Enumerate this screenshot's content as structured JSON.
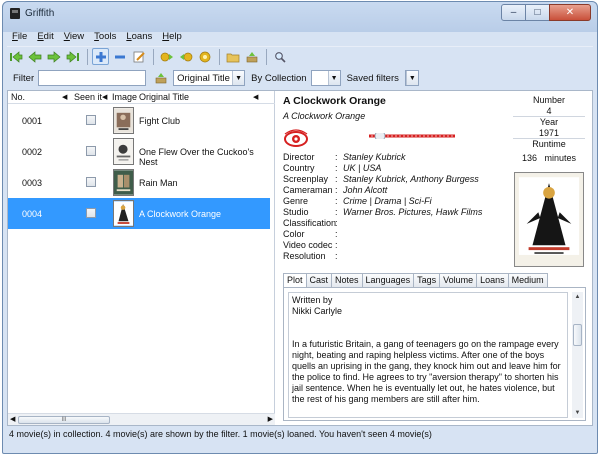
{
  "window": {
    "title": "Griffith",
    "icon": "griffith-app-icon"
  },
  "window_buttons": {
    "minimize": "–",
    "maximize": "□",
    "close": "✕"
  },
  "menu": [
    {
      "label": "File",
      "mnemonic": "F",
      "rest": "ile"
    },
    {
      "label": "Edit",
      "mnemonic": "E",
      "rest": "dit"
    },
    {
      "label": "View",
      "mnemonic": "V",
      "rest": "iew"
    },
    {
      "label": "Tools",
      "mnemonic": "T",
      "rest": "ools"
    },
    {
      "label": "Loans",
      "mnemonic": "L",
      "rest": "oans"
    },
    {
      "label": "Help",
      "mnemonic": "H",
      "rest": "elp"
    }
  ],
  "toolbar": {
    "icons": [
      "first-icon",
      "previous-icon",
      "next-icon",
      "last-icon",
      "add-icon",
      "delete-icon",
      "edit-icon",
      "loan-icon",
      "return-icon",
      "email-icon",
      "open-folder-icon",
      "export-icon",
      "search-icon"
    ]
  },
  "filter": {
    "label": "Filter",
    "value": "",
    "field_select": "Original Title",
    "collection_button": "By Collection",
    "collection_select": "",
    "saved_filters_label": "Saved filters",
    "saved_filters_select": ""
  },
  "list": {
    "columns": {
      "no": "No.",
      "seen": "Seen it",
      "image": "Image",
      "original_title": "Original Title"
    },
    "rows": [
      {
        "no": "0001",
        "seen": false,
        "title": "Fight Club",
        "selected": false
      },
      {
        "no": "0002",
        "seen": false,
        "title": "One Flew Over the Cuckoo's Nest",
        "selected": false
      },
      {
        "no": "0003",
        "seen": false,
        "title": "Rain Man",
        "selected": false
      },
      {
        "no": "0004",
        "seen": false,
        "title": "A Clockwork Orange",
        "selected": true
      }
    ],
    "scroll_grip": "III"
  },
  "detail": {
    "title": "A Clockwork Orange",
    "original_title": "A Clockwork Orange",
    "rating": 0.1,
    "fields": [
      {
        "key": "Director",
        "value": "Stanley Kubrick"
      },
      {
        "key": "Country",
        "value": "UK | USA"
      },
      {
        "key": "Screenplay",
        "value": "Stanley Kubrick, Anthony Burgess"
      },
      {
        "key": "Cameraman",
        "value": "John Alcott"
      },
      {
        "key": "Genre",
        "value": "Crime | Drama | Sci-Fi"
      },
      {
        "key": "Studio",
        "value": "Warner Bros. Pictures, Hawk Films"
      },
      {
        "key": "Classification",
        "value": ""
      },
      {
        "key": "Color",
        "value": ""
      },
      {
        "key": "Video codec",
        "value": ""
      },
      {
        "key": "Resolution",
        "value": ""
      }
    ],
    "separator": ":",
    "number_label": "Number",
    "number": "4",
    "year_label": "Year",
    "year": "1971",
    "runtime_label": "Runtime",
    "runtime": "136",
    "runtime_unit": "minutes"
  },
  "tabs": [
    {
      "label": "Plot",
      "active": true
    },
    {
      "label": "Cast",
      "active": false
    },
    {
      "label": "Notes",
      "active": false
    },
    {
      "label": "Languages",
      "active": false
    },
    {
      "label": "Tags",
      "active": false
    },
    {
      "label": "Volume",
      "active": false
    },
    {
      "label": "Loans",
      "active": false
    },
    {
      "label": "Medium",
      "active": false
    }
  ],
  "plot": {
    "written_by_label": "Written by",
    "author": "Nikki Carlyle",
    "text": "In a futuristic Britain, a gang of teenagers go on the rampage every night, beating and raping helpless victims. After one of the boys quells an uprising in the gang, they knock him out and leave him for the police to find. He agrees to try \"aversion therapy\" to shorten his jail sentence. When he is eventually let out, he hates violence, but the rest of his gang members are still after him."
  },
  "status": "4 movie(s) in collection. 4 movie(s) are shown by the filter. 1 movie(s) loaned. You haven't seen 4 movie(s)"
}
